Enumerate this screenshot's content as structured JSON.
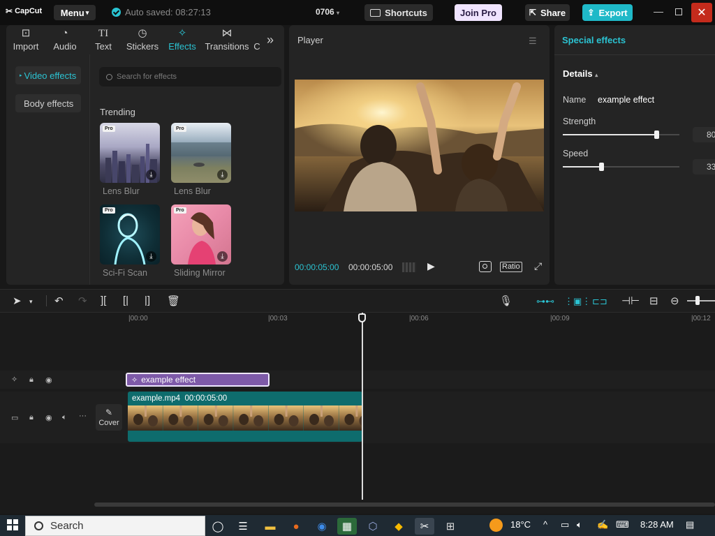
{
  "titlebar": {
    "app_name": "CapCut",
    "menu_label": "Menu",
    "autosave_text": "Auto saved: 08:27:13",
    "project_name": "0706",
    "shortcuts_label": "Shortcuts",
    "joinpro_label": "Join Pro",
    "share_label": "Share",
    "export_label": "Export"
  },
  "media_tabs": [
    {
      "label": "Import",
      "icon": "import-icon"
    },
    {
      "label": "Audio",
      "icon": "audio-icon"
    },
    {
      "label": "Text",
      "icon": "text-icon"
    },
    {
      "label": "Stickers",
      "icon": "stickers-icon"
    },
    {
      "label": "Effects",
      "icon": "effects-icon",
      "active": true
    },
    {
      "label": "Transitions",
      "icon": "transitions-icon"
    },
    {
      "label": "C",
      "icon": "more-icon"
    }
  ],
  "effects_panel": {
    "categories": [
      "Video effects",
      "Body effects"
    ],
    "search_placeholder": "Search for effects",
    "section_title": "Trending",
    "pro_badge": "Pro",
    "items": [
      {
        "label": "Lens Blur"
      },
      {
        "label": "Lens Blur"
      },
      {
        "label": "Sci-Fi Scan"
      },
      {
        "label": "Sliding Mirror"
      }
    ]
  },
  "player": {
    "title": "Player",
    "current_time": "00:00:05:00",
    "total_time": "00:00:05:00",
    "ratio_label": "Ratio"
  },
  "special_effects": {
    "title": "Special effects",
    "details_label": "Details",
    "name_label": "Name",
    "name_value": "example effect",
    "strength_label": "Strength",
    "strength_value": "80",
    "strength_level": 0.8,
    "speed_label": "Speed",
    "speed_value": "33",
    "speed_level": 0.33
  },
  "timeline": {
    "ruler": [
      "00:00",
      "00:03",
      "00:06",
      "00:09",
      "00:12"
    ],
    "effect_clip_label": "example effect",
    "video_clip_name": "example.mp4",
    "video_clip_duration": "00:00:05:00",
    "cover_label": "Cover"
  },
  "taskbar": {
    "search_label": "Search",
    "temperature": "18°C",
    "time": "8:28 AM"
  },
  "colors": {
    "accent": "#2bc3d2",
    "export": "#1fb9c8",
    "effect_clip": "#7e5aa8",
    "video_clip": "#0e6c6d",
    "close": "#c42b1c"
  }
}
